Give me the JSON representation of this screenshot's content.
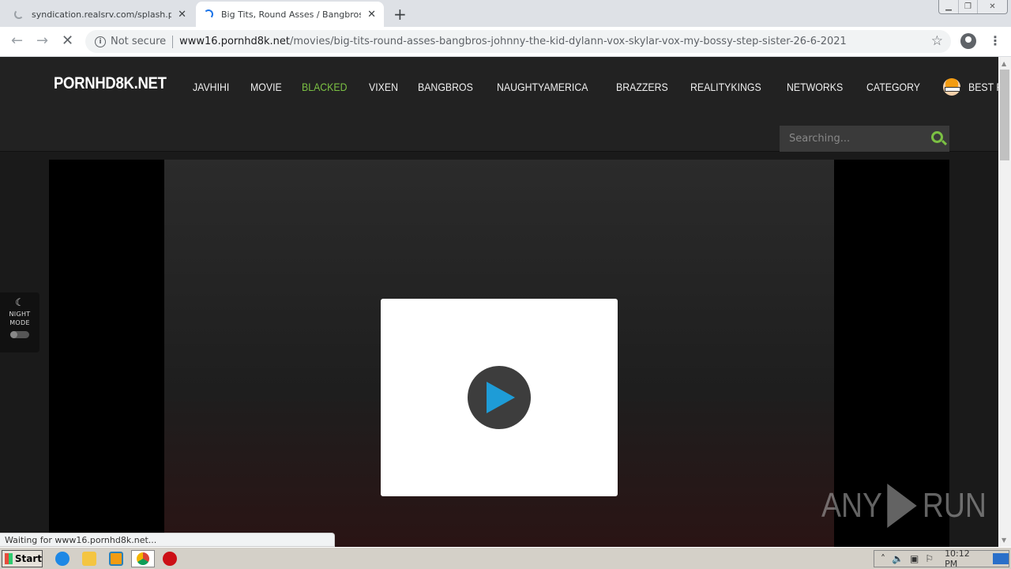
{
  "browser": {
    "tabs": [
      {
        "title": "syndication.realsrv.com/splash.php?",
        "loading": true
      },
      {
        "title": "Big Tits, Round Asses / Bangbros - J",
        "loading": true,
        "active": true
      }
    ],
    "new_tab_label": "+",
    "security_label": "Not secure",
    "url_host": "www16.pornhd8k.net",
    "url_path": "/movies/big-tits-round-asses-bangbros-johnny-the-kid-dylann-vox-skylar-vox-my-bossy-step-sister-26-6-2021",
    "status_text": "Waiting for www16.pornhd8k.net..."
  },
  "site": {
    "logo": "PORNHD8K.NET",
    "nav": [
      {
        "label": "JAVHIHI"
      },
      {
        "label": "MOVIE"
      },
      {
        "label": "BLACKED",
        "active": true
      },
      {
        "label": "VIXEN"
      },
      {
        "label": "BANGBROS"
      },
      {
        "label": "NAUGHTYAMERICA"
      },
      {
        "label": "BRAZZERS"
      },
      {
        "label": "REALITYKINGS"
      },
      {
        "label": "NETWORKS"
      },
      {
        "label": "CATEGORY"
      },
      {
        "label": "BEST PORN SITES"
      }
    ],
    "search_placeholder": "Searching...",
    "night_mode": {
      "icon": "moon-icon",
      "label_line1": "NIGHT",
      "label_line2": "MODE",
      "enabled": false
    },
    "accent_color": "#7bc043",
    "play_color": "#1e9cd7"
  },
  "watermark": {
    "left": "ANY",
    "right": "RUN"
  },
  "taskbar": {
    "start_label": "Start",
    "clock": "10:12 PM"
  }
}
